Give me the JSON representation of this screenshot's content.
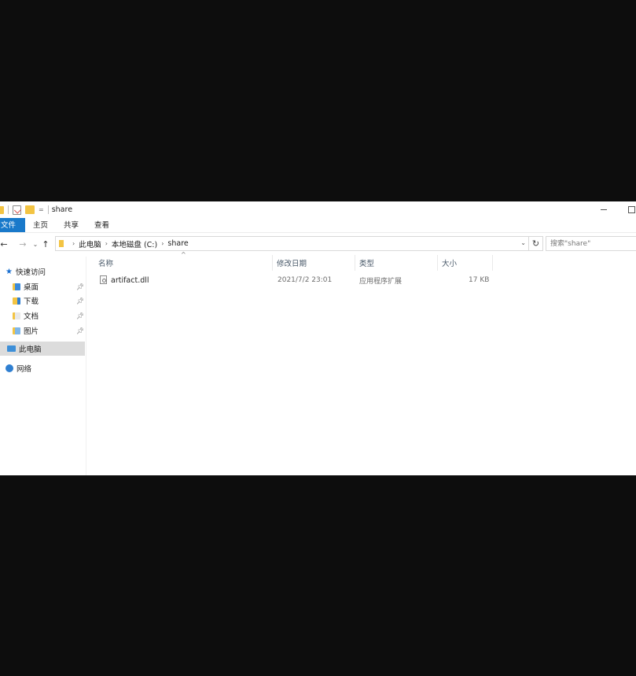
{
  "window": {
    "title": "share",
    "quick_access_dropdown": "="
  },
  "ribbon": {
    "tabs": [
      "文件",
      "主页",
      "共享",
      "查看"
    ]
  },
  "address": {
    "crumbs": [
      "此电脑",
      "本地磁盘 (C:)",
      "share"
    ],
    "search_placeholder": "搜索\"share\""
  },
  "navpane": {
    "quick_access": "快速访问",
    "items": [
      {
        "label": "桌面",
        "icon": "desktop-folder-icon",
        "pinned": true
      },
      {
        "label": "下载",
        "icon": "downloads-folder-icon",
        "pinned": true
      },
      {
        "label": "文档",
        "icon": "documents-folder-icon",
        "pinned": true
      },
      {
        "label": "图片",
        "icon": "pictures-folder-icon",
        "pinned": true
      }
    ],
    "this_pc": "此电脑",
    "network": "网络"
  },
  "columns": {
    "name": "名称",
    "modified": "修改日期",
    "type": "类型",
    "size": "大小"
  },
  "files": [
    {
      "name": "artifact.dll",
      "modified": "2021/7/2 23:01",
      "type": "应用程序扩展",
      "size": "17 KB",
      "icon": "dll-file-icon"
    }
  ],
  "colors": {
    "file_tab_bg": "#1979ca",
    "selected_nav_bg": "#dcdcdc",
    "folder_yellow": "#f3c443"
  }
}
